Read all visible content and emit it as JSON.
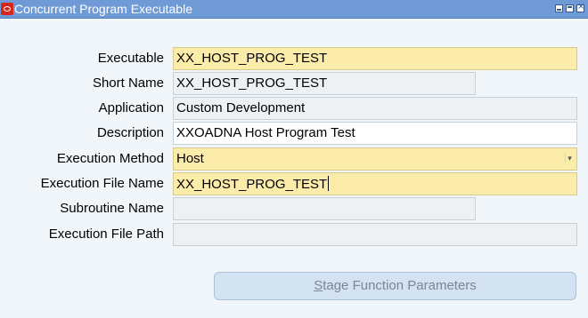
{
  "window": {
    "title": "Concurrent Program Executable"
  },
  "form": {
    "fields": [
      {
        "label": "Executable",
        "value": "XX_HOST_PROG_TEST"
      },
      {
        "label": "Short Name",
        "value": "XX_HOST_PROG_TEST"
      },
      {
        "label": "Application",
        "value": "Custom Development"
      },
      {
        "label": "Description",
        "value": "XXOADNA Host Program Test"
      },
      {
        "label": "Execution Method",
        "value": "Host"
      },
      {
        "label": "Execution File Name",
        "value": "XX_HOST_PROG_TEST"
      },
      {
        "label": "Subroutine Name",
        "value": ""
      },
      {
        "label": "Execution File Path",
        "value": ""
      }
    ]
  },
  "actions": {
    "stage_button_first_letter": "S",
    "stage_button_rest": "tage Function Parameters"
  },
  "colors": {
    "titlebar": "#6f9ad6",
    "required_field": "#fcecaa",
    "readonly_field": "#eef1f4",
    "background": "#f1f6fa"
  }
}
